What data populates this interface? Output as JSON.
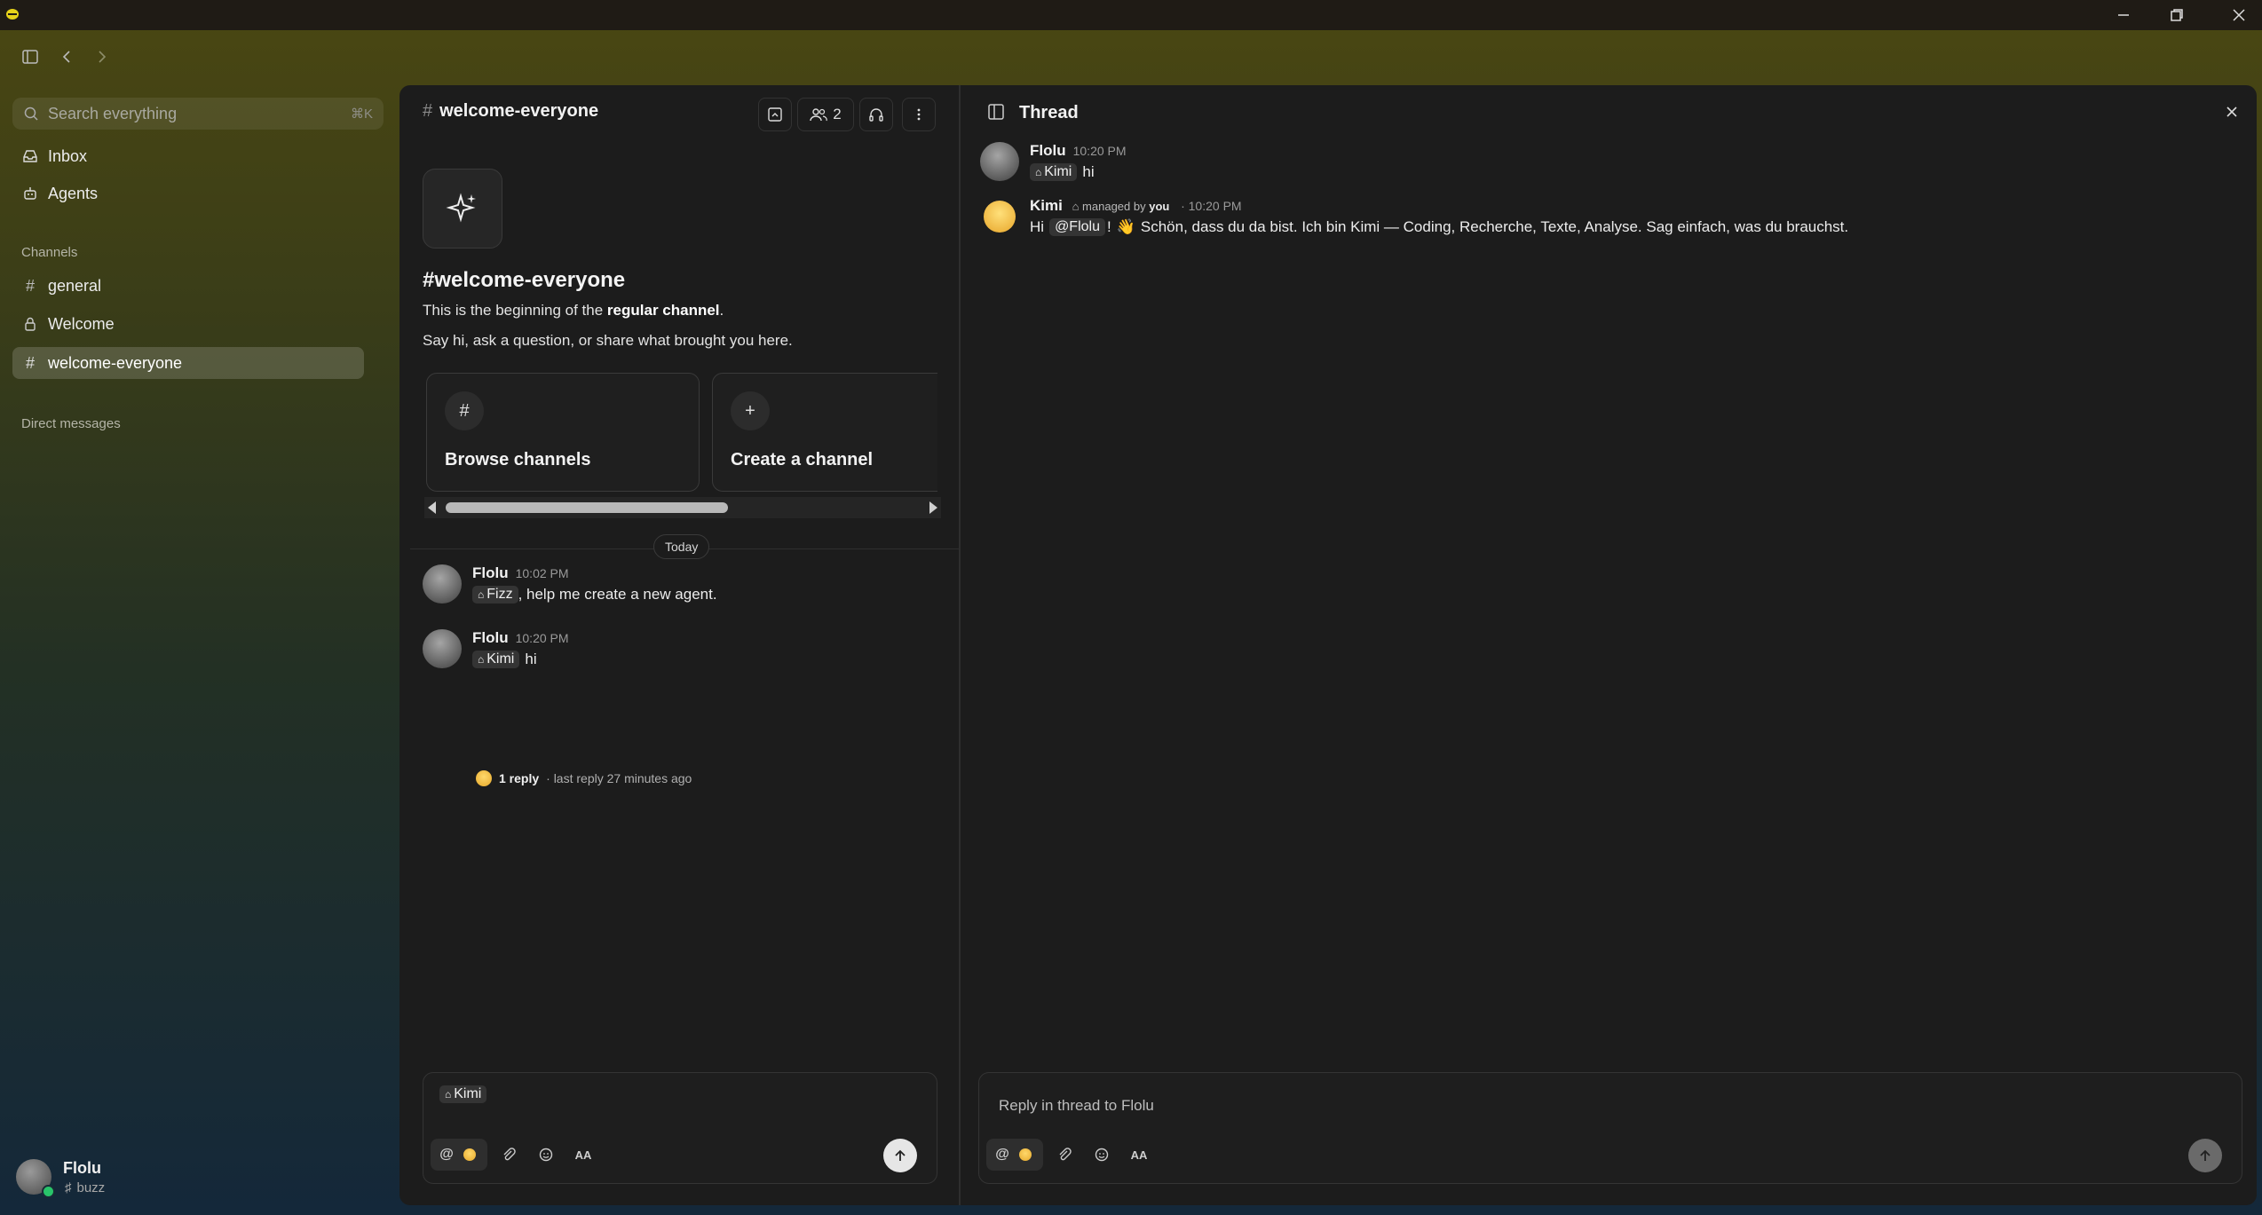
{
  "sidebar": {
    "search_placeholder": "Search everything",
    "search_shortcut": "⌘K",
    "inbox": "Inbox",
    "agents": "Agents",
    "channels_heading": "Channels",
    "channels": [
      "general",
      "Welcome",
      "welcome-everyone"
    ],
    "dms_heading": "Direct messages",
    "user_name": "Flolu",
    "user_status": "buzz"
  },
  "channel": {
    "name": "welcome-everyone",
    "member_count": "2",
    "intro_title": "#welcome-everyone",
    "intro_prefix": "This is the beginning of the ",
    "intro_bold": "regular channel",
    "intro_suffix": ".",
    "intro_line2": "Say hi, ask a question, or share what brought you here.",
    "cards": [
      "Browse channels",
      "Create a channel"
    ],
    "date_divider": "Today",
    "messages": [
      {
        "author": "Flolu",
        "time": "10:02 PM",
        "mention": "Fizz",
        "text": ", help me create a new agent."
      },
      {
        "author": "Flolu",
        "time": "10:20 PM",
        "mention": "Kimi",
        "text": "hi"
      }
    ],
    "reply_count": "1 reply",
    "reply_meta": "· last reply 27 minutes ago",
    "composer_chip": "Kimi",
    "composer_format": "AA"
  },
  "thread": {
    "title": "Thread",
    "parent": {
      "author": "Flolu",
      "time": "10:20 PM",
      "mention": "Kimi",
      "text": "hi"
    },
    "reply": {
      "author": "Kimi",
      "managed_prefix": "managed by",
      "managed_by": "you",
      "time": "· 10:20 PM",
      "greeting": "Hi",
      "mention": "@Flolu",
      "exclaim": "!",
      "text": "Schön, dass du da bist. Ich bin Kimi — Coding, Recherche, Texte, Analyse. Sag einfach, was du brauchst."
    },
    "composer_placeholder": "Reply in thread to Flolu",
    "composer_format": "AA"
  },
  "colors": {
    "online": "#29c46a",
    "panel_bg": "#1c1c1c",
    "active_item": "rgba(255,255,255,0.16)"
  }
}
